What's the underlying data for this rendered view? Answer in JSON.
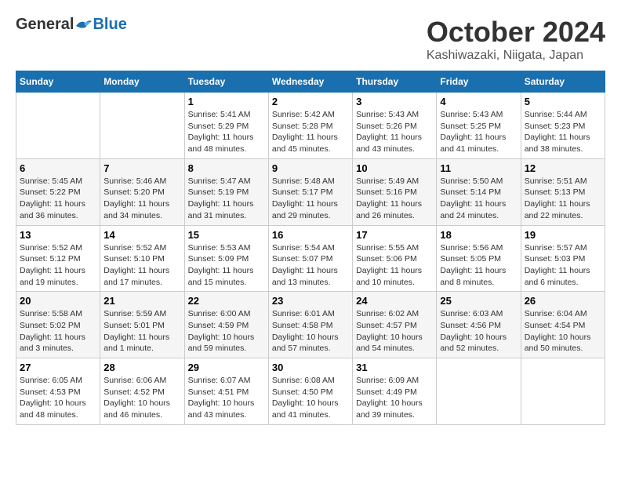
{
  "header": {
    "logo_general": "General",
    "logo_blue": "Blue",
    "month": "October 2024",
    "location": "Kashiwazaki, Niigata, Japan"
  },
  "weekdays": [
    "Sunday",
    "Monday",
    "Tuesday",
    "Wednesday",
    "Thursday",
    "Friday",
    "Saturday"
  ],
  "weeks": [
    [
      {
        "day": "",
        "sunrise": "",
        "sunset": "",
        "daylight": ""
      },
      {
        "day": "",
        "sunrise": "",
        "sunset": "",
        "daylight": ""
      },
      {
        "day": "1",
        "sunrise": "Sunrise: 5:41 AM",
        "sunset": "Sunset: 5:29 PM",
        "daylight": "Daylight: 11 hours and 48 minutes."
      },
      {
        "day": "2",
        "sunrise": "Sunrise: 5:42 AM",
        "sunset": "Sunset: 5:28 PM",
        "daylight": "Daylight: 11 hours and 45 minutes."
      },
      {
        "day": "3",
        "sunrise": "Sunrise: 5:43 AM",
        "sunset": "Sunset: 5:26 PM",
        "daylight": "Daylight: 11 hours and 43 minutes."
      },
      {
        "day": "4",
        "sunrise": "Sunrise: 5:43 AM",
        "sunset": "Sunset: 5:25 PM",
        "daylight": "Daylight: 11 hours and 41 minutes."
      },
      {
        "day": "5",
        "sunrise": "Sunrise: 5:44 AM",
        "sunset": "Sunset: 5:23 PM",
        "daylight": "Daylight: 11 hours and 38 minutes."
      }
    ],
    [
      {
        "day": "6",
        "sunrise": "Sunrise: 5:45 AM",
        "sunset": "Sunset: 5:22 PM",
        "daylight": "Daylight: 11 hours and 36 minutes."
      },
      {
        "day": "7",
        "sunrise": "Sunrise: 5:46 AM",
        "sunset": "Sunset: 5:20 PM",
        "daylight": "Daylight: 11 hours and 34 minutes."
      },
      {
        "day": "8",
        "sunrise": "Sunrise: 5:47 AM",
        "sunset": "Sunset: 5:19 PM",
        "daylight": "Daylight: 11 hours and 31 minutes."
      },
      {
        "day": "9",
        "sunrise": "Sunrise: 5:48 AM",
        "sunset": "Sunset: 5:17 PM",
        "daylight": "Daylight: 11 hours and 29 minutes."
      },
      {
        "day": "10",
        "sunrise": "Sunrise: 5:49 AM",
        "sunset": "Sunset: 5:16 PM",
        "daylight": "Daylight: 11 hours and 26 minutes."
      },
      {
        "day": "11",
        "sunrise": "Sunrise: 5:50 AM",
        "sunset": "Sunset: 5:14 PM",
        "daylight": "Daylight: 11 hours and 24 minutes."
      },
      {
        "day": "12",
        "sunrise": "Sunrise: 5:51 AM",
        "sunset": "Sunset: 5:13 PM",
        "daylight": "Daylight: 11 hours and 22 minutes."
      }
    ],
    [
      {
        "day": "13",
        "sunrise": "Sunrise: 5:52 AM",
        "sunset": "Sunset: 5:12 PM",
        "daylight": "Daylight: 11 hours and 19 minutes."
      },
      {
        "day": "14",
        "sunrise": "Sunrise: 5:52 AM",
        "sunset": "Sunset: 5:10 PM",
        "daylight": "Daylight: 11 hours and 17 minutes."
      },
      {
        "day": "15",
        "sunrise": "Sunrise: 5:53 AM",
        "sunset": "Sunset: 5:09 PM",
        "daylight": "Daylight: 11 hours and 15 minutes."
      },
      {
        "day": "16",
        "sunrise": "Sunrise: 5:54 AM",
        "sunset": "Sunset: 5:07 PM",
        "daylight": "Daylight: 11 hours and 13 minutes."
      },
      {
        "day": "17",
        "sunrise": "Sunrise: 5:55 AM",
        "sunset": "Sunset: 5:06 PM",
        "daylight": "Daylight: 11 hours and 10 minutes."
      },
      {
        "day": "18",
        "sunrise": "Sunrise: 5:56 AM",
        "sunset": "Sunset: 5:05 PM",
        "daylight": "Daylight: 11 hours and 8 minutes."
      },
      {
        "day": "19",
        "sunrise": "Sunrise: 5:57 AM",
        "sunset": "Sunset: 5:03 PM",
        "daylight": "Daylight: 11 hours and 6 minutes."
      }
    ],
    [
      {
        "day": "20",
        "sunrise": "Sunrise: 5:58 AM",
        "sunset": "Sunset: 5:02 PM",
        "daylight": "Daylight: 11 hours and 3 minutes."
      },
      {
        "day": "21",
        "sunrise": "Sunrise: 5:59 AM",
        "sunset": "Sunset: 5:01 PM",
        "daylight": "Daylight: 11 hours and 1 minute."
      },
      {
        "day": "22",
        "sunrise": "Sunrise: 6:00 AM",
        "sunset": "Sunset: 4:59 PM",
        "daylight": "Daylight: 10 hours and 59 minutes."
      },
      {
        "day": "23",
        "sunrise": "Sunrise: 6:01 AM",
        "sunset": "Sunset: 4:58 PM",
        "daylight": "Daylight: 10 hours and 57 minutes."
      },
      {
        "day": "24",
        "sunrise": "Sunrise: 6:02 AM",
        "sunset": "Sunset: 4:57 PM",
        "daylight": "Daylight: 10 hours and 54 minutes."
      },
      {
        "day": "25",
        "sunrise": "Sunrise: 6:03 AM",
        "sunset": "Sunset: 4:56 PM",
        "daylight": "Daylight: 10 hours and 52 minutes."
      },
      {
        "day": "26",
        "sunrise": "Sunrise: 6:04 AM",
        "sunset": "Sunset: 4:54 PM",
        "daylight": "Daylight: 10 hours and 50 minutes."
      }
    ],
    [
      {
        "day": "27",
        "sunrise": "Sunrise: 6:05 AM",
        "sunset": "Sunset: 4:53 PM",
        "daylight": "Daylight: 10 hours and 48 minutes."
      },
      {
        "day": "28",
        "sunrise": "Sunrise: 6:06 AM",
        "sunset": "Sunset: 4:52 PM",
        "daylight": "Daylight: 10 hours and 46 minutes."
      },
      {
        "day": "29",
        "sunrise": "Sunrise: 6:07 AM",
        "sunset": "Sunset: 4:51 PM",
        "daylight": "Daylight: 10 hours and 43 minutes."
      },
      {
        "day": "30",
        "sunrise": "Sunrise: 6:08 AM",
        "sunset": "Sunset: 4:50 PM",
        "daylight": "Daylight: 10 hours and 41 minutes."
      },
      {
        "day": "31",
        "sunrise": "Sunrise: 6:09 AM",
        "sunset": "Sunset: 4:49 PM",
        "daylight": "Daylight: 10 hours and 39 minutes."
      },
      {
        "day": "",
        "sunrise": "",
        "sunset": "",
        "daylight": ""
      },
      {
        "day": "",
        "sunrise": "",
        "sunset": "",
        "daylight": ""
      }
    ]
  ]
}
